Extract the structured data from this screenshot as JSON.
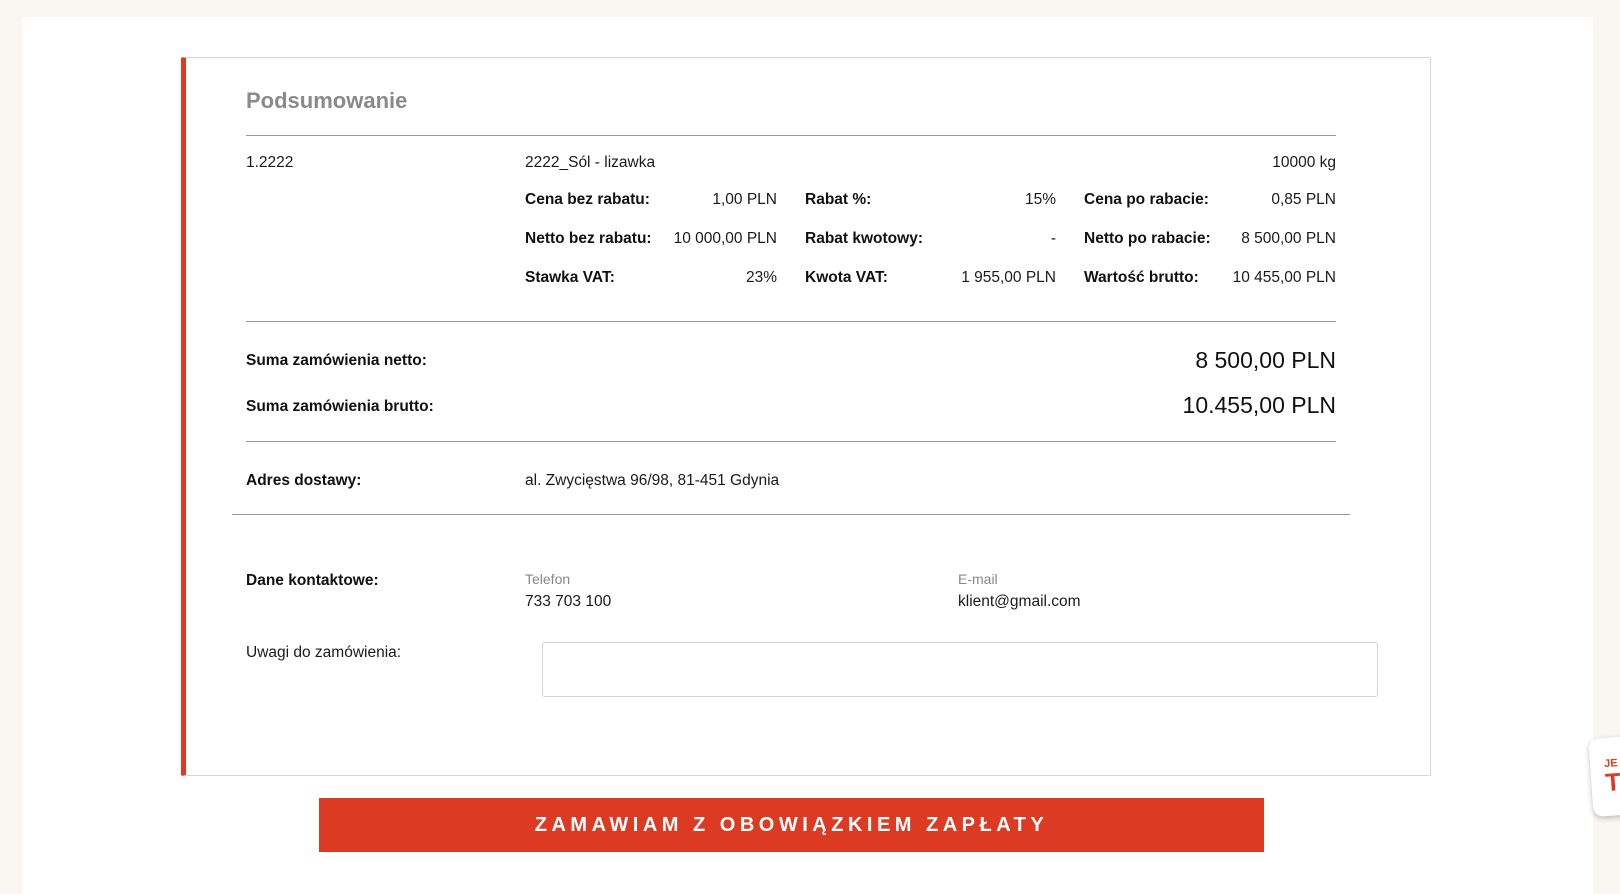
{
  "summary": {
    "title": "Podsumowanie",
    "item": {
      "code": "1.2222",
      "name": "2222_Sól - lizawka",
      "quantity": "10000 kg",
      "price_no_discount_label": "Cena bez rabatu:",
      "price_no_discount": "1,00 PLN",
      "discount_pct_label": "Rabat %:",
      "discount_pct": "15%",
      "price_after_discount_label": "Cena po rabacie:",
      "price_after_discount": "0,85 PLN",
      "net_no_discount_label": "Netto bez rabatu:",
      "net_no_discount": "10 000,00 PLN",
      "discount_amount_label": "Rabat kwotowy:",
      "discount_amount": "-",
      "net_after_discount_label": "Netto po rabacie:",
      "net_after_discount": "8 500,00 PLN",
      "vat_rate_label": "Stawka VAT:",
      "vat_rate": "23%",
      "vat_amount_label": "Kwota VAT:",
      "vat_amount": "1 955,00 PLN",
      "gross_value_label": "Wartość brutto:",
      "gross_value": "10 455,00 PLN"
    },
    "totals": {
      "net_label": "Suma zamówienia netto:",
      "net": "8 500,00 PLN",
      "gross_label": "Suma zamówienia brutto:",
      "gross": "10.455,00 PLN"
    },
    "delivery": {
      "label": "Adres dostawy:",
      "address": "al. Zwycięstwa 96/98, 81-451 Gdynia"
    },
    "contact": {
      "label": "Dane kontaktowe:",
      "phone_label": "Telefon",
      "phone": "733 703 100",
      "email_label": "E-mail",
      "email": "klient@gmail.com"
    },
    "notes": {
      "label": "Uwagi do zamówienia:",
      "value": "",
      "placeholder": ""
    }
  },
  "submit_label": "ZAMAWIAM Z OBOWIĄZKIEM ZAPŁATY",
  "badge": {
    "line1": "JE",
    "line2": "TU"
  },
  "colors": {
    "accent": "#dc3a22",
    "background": "#faf7f3",
    "muted": "#8a8a8a"
  }
}
